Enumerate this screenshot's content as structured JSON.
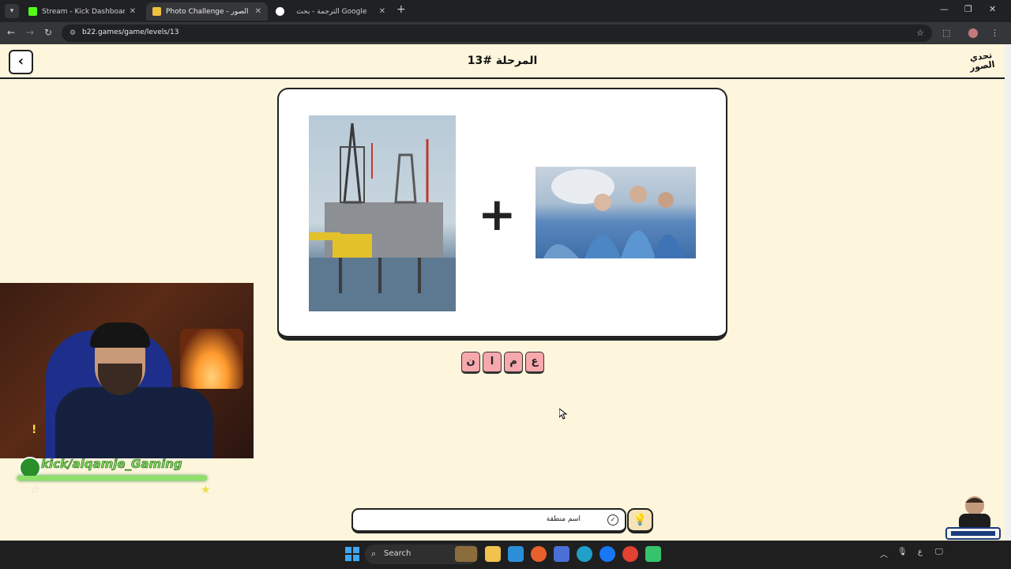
{
  "browser": {
    "tabs": [
      {
        "title": "Stream - Kick Dashboard",
        "active": false
      },
      {
        "title": "Photo Challenge - تحدي الصور",
        "active": true
      },
      {
        "title": "الترجمة - بحث Google",
        "active": false
      }
    ],
    "url": "b22.games/game/levels/13",
    "icons": {
      "back": "back-arrow-icon",
      "forward": "forward-arrow-icon",
      "reload": "reload-icon",
      "bookmark": "star-icon"
    }
  },
  "game": {
    "level_title": "المرحلة #13",
    "logo_text": "تحدي الصور",
    "back_icon": "chevron-left-icon",
    "plus_symbol": "+",
    "tiles": [
      "ن",
      "ا",
      "م",
      "ع"
    ],
    "hint_text": "اسم منطقة",
    "hint_icon": "lightbulb-icon",
    "images": [
      "oil rig photo",
      "surgeons photo"
    ]
  },
  "stream_overlay": {
    "channel_name": "kick/alqamje_Gaming"
  },
  "taskbar": {
    "search_label": "Search",
    "tray_lang": "ع"
  },
  "colors": {
    "page_bg": "#fdf5dc",
    "tile_bg": "#f6a8ad",
    "accent_dark": "#222222"
  }
}
